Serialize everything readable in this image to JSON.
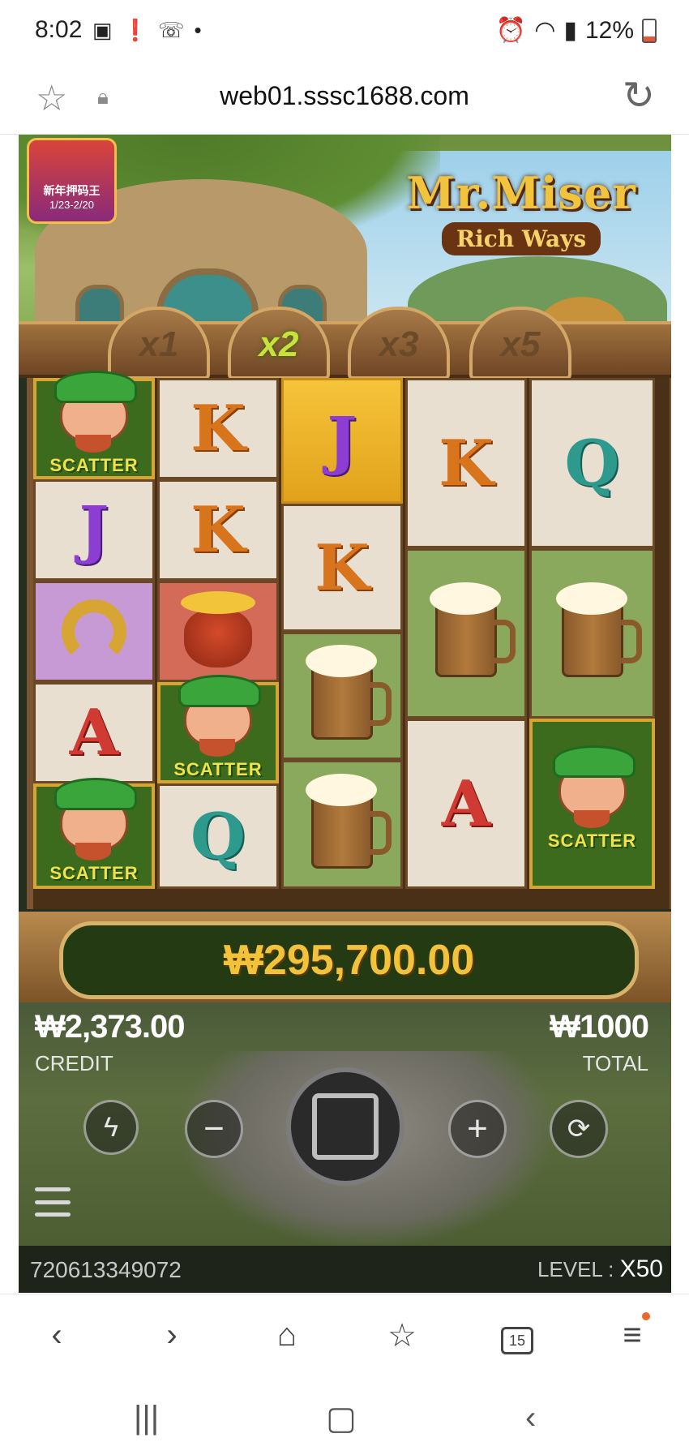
{
  "status": {
    "time": "8:02",
    "battery": "12%"
  },
  "browser": {
    "url": "web01.sssc1688.com",
    "tabs_count": "15"
  },
  "game": {
    "promo": {
      "line1": "新年押码王",
      "line2": "1/23-2/20"
    },
    "logo": {
      "title": "Mr.Miser",
      "subtitle": "Rich Ways"
    },
    "multipliers": [
      {
        "label": "x1",
        "active": false
      },
      {
        "label": "x2",
        "active": true
      },
      {
        "label": "x3",
        "active": false
      },
      {
        "label": "x5",
        "active": false
      }
    ],
    "symbols": {
      "K": "K",
      "Q": "Q",
      "J": "J",
      "A": "A",
      "scatter": "SCATTER"
    },
    "win_amount": "₩295,700.00",
    "credit_value": "₩2,373.00",
    "credit_label": "CREDIT",
    "total_value": "₩1000",
    "total_label": "TOTAL",
    "round_id": "720613349072",
    "level_label": "LEVEL :",
    "level_value": "X50"
  }
}
